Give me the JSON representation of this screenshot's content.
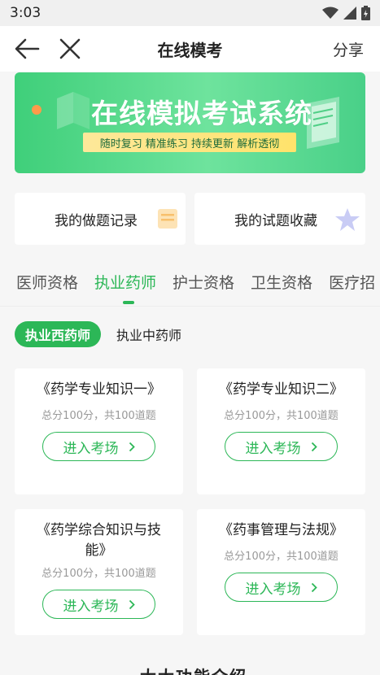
{
  "status": {
    "time": "3:03"
  },
  "nav": {
    "title": "在线模考",
    "share": "分享"
  },
  "banner": {
    "title": "在线模拟考试系统",
    "subtitle": "随时复习 精准练习 持续更新 解析透彻"
  },
  "quick_links": [
    {
      "label": "我的做题记录"
    },
    {
      "label": "我的试题收藏"
    }
  ],
  "tabs": [
    "医师资格",
    "执业药师",
    "护士资格",
    "卫生资格",
    "医疗招"
  ],
  "subtabs": [
    "执业西药师",
    "执业中药师"
  ],
  "exams": [
    {
      "title": "《药学专业知识一》",
      "meta": "总分100分，共100道题",
      "button": "进入考场"
    },
    {
      "title": "《药学专业知识二》",
      "meta": "总分100分，共100道题",
      "button": "进入考场"
    },
    {
      "title": "《药学综合知识与技能》",
      "meta": "总分100分，共100道题",
      "button": "进入考场"
    },
    {
      "title": "《药事管理与法规》",
      "meta": "总分100分，共100道题",
      "button": "进入考场"
    }
  ],
  "bottom_heading": "大大功能介绍",
  "colors": {
    "accent": "#2cb757",
    "background": "#f6f6f6"
  }
}
